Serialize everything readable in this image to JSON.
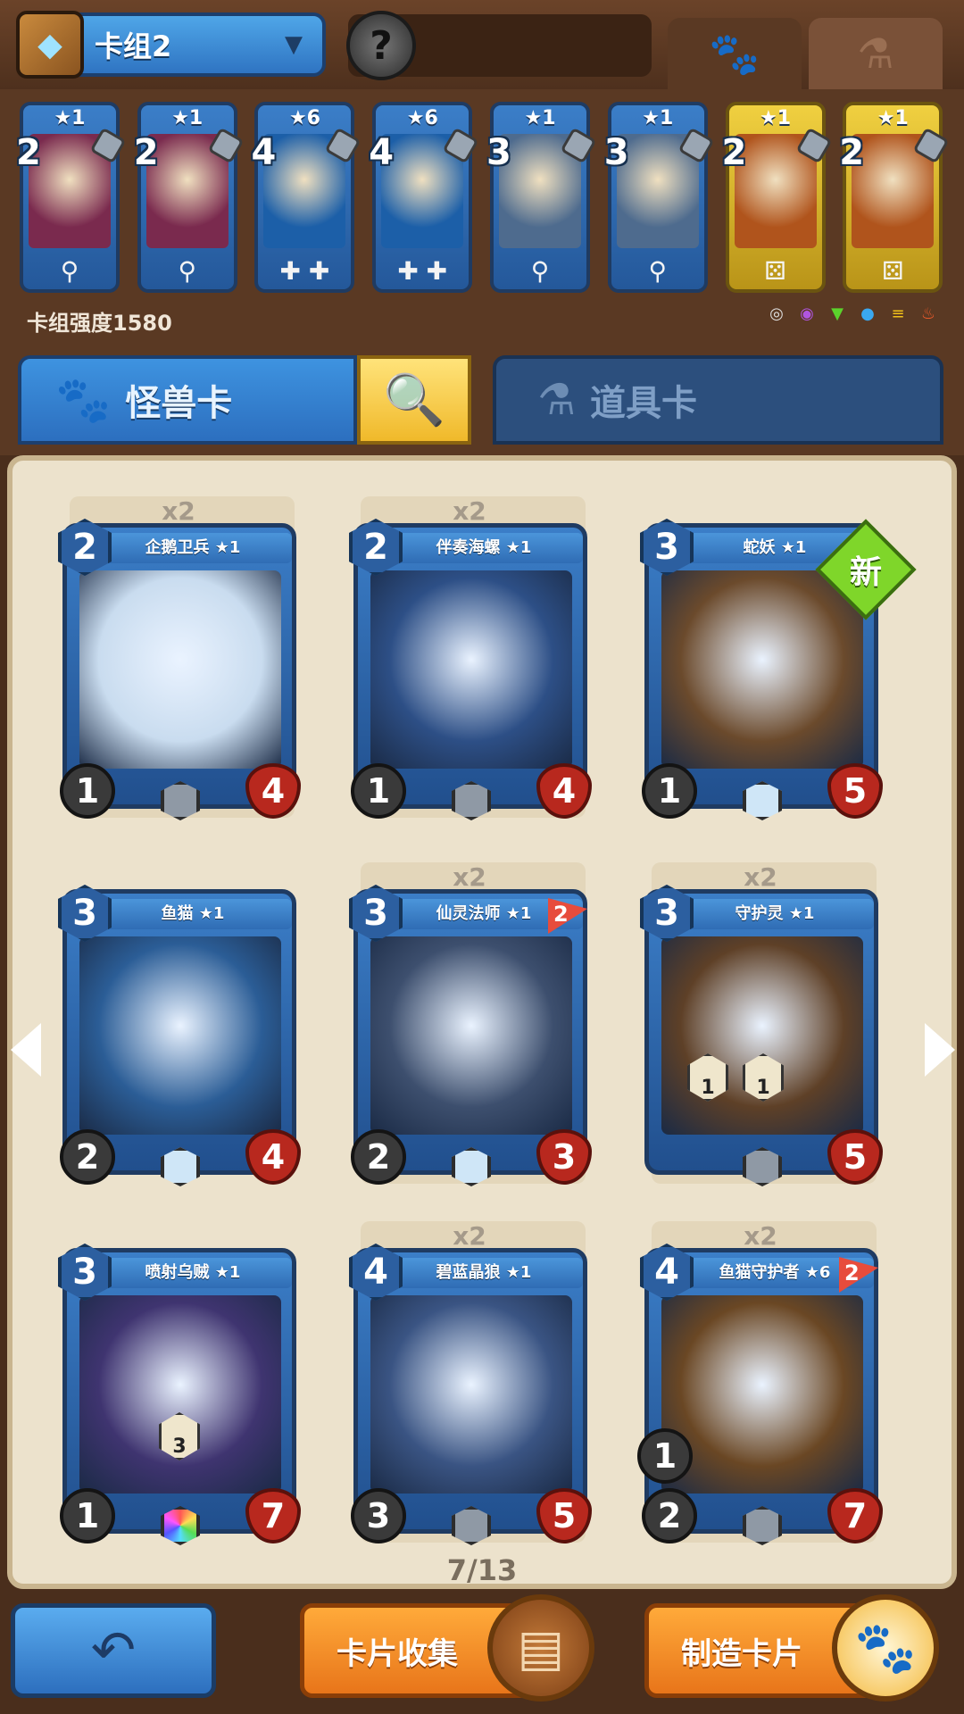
{
  "top": {
    "deck_name": "卡组2",
    "profile_icon": "?"
  },
  "deck": {
    "power_label": "卡组强度1580",
    "cards": [
      {
        "stars": "★1",
        "cost": "2",
        "foot": "⚲",
        "theme": "blue",
        "art": "#7a2a4e"
      },
      {
        "stars": "★1",
        "cost": "2",
        "foot": "⚲",
        "theme": "blue",
        "art": "#7a2a4e"
      },
      {
        "stars": "★6",
        "cost": "4",
        "foot": "✚ ✚",
        "theme": "blue",
        "art": "#1c5fa8"
      },
      {
        "stars": "★6",
        "cost": "4",
        "foot": "✚ ✚",
        "theme": "blue",
        "art": "#1c5fa8"
      },
      {
        "stars": "★1",
        "cost": "3",
        "foot": "⚲",
        "theme": "blue",
        "art": "#4e6b8e"
      },
      {
        "stars": "★1",
        "cost": "3",
        "foot": "⚲",
        "theme": "blue",
        "art": "#4e6b8e"
      },
      {
        "stars": "★1",
        "cost": "2",
        "foot": "⚄",
        "theme": "gold",
        "art": "#b0541c"
      },
      {
        "stars": "★1",
        "cost": "2",
        "foot": "⚄",
        "theme": "gold",
        "art": "#b0541c"
      }
    ],
    "elements": [
      {
        "icon": "◎",
        "color": "#e0e0e0"
      },
      {
        "icon": "◉",
        "color": "#b055e0"
      },
      {
        "icon": "▼",
        "color": "#5bd22c"
      },
      {
        "icon": "●",
        "color": "#3aa8f0"
      },
      {
        "icon": "≡",
        "color": "#f2c21a"
      },
      {
        "icon": "♨",
        "color": "#f05a2a"
      }
    ]
  },
  "tabs": {
    "monster_label": "怪兽卡",
    "item_label": "道具卡"
  },
  "collection": {
    "page": "7/13",
    "new_badge": "新",
    "cards": [
      {
        "copies": "x2",
        "name": "企鹅卫兵 ★1",
        "cost": "2",
        "atk": "1",
        "hp": "4",
        "gem": "grey",
        "art": "#c9dcef"
      },
      {
        "copies": "x2",
        "name": "伴奏海螺 ★1",
        "cost": "2",
        "atk": "1",
        "hp": "4",
        "gem": "grey",
        "art": "#2d4f86"
      },
      {
        "copies": "",
        "name": "蛇妖 ★1",
        "cost": "3",
        "atk": "1",
        "hp": "5",
        "gem": "crystal",
        "art": "#6b4a2c"
      },
      {
        "copies": "",
        "name": "鱼猫 ★1",
        "cost": "3",
        "atk": "2",
        "hp": "4",
        "gem": "crystal",
        "art": "#2b5d96"
      },
      {
        "copies": "x2",
        "name": "仙灵法师 ★1",
        "cost": "3",
        "atk": "2",
        "hp": "3",
        "gem": "crystal",
        "art": "#3d4f6e",
        "flag": "2"
      },
      {
        "copies": "x2",
        "name": "守护灵 ★1",
        "cost": "3",
        "atk": "",
        "hp": "5",
        "gem": "grey",
        "art": "#5e4027",
        "abilities": [
          "1",
          "1"
        ]
      },
      {
        "copies": "",
        "name": "喷射乌贼 ★1",
        "cost": "3",
        "atk": "1",
        "hp": "7",
        "gem": "rainbow",
        "art": "#3f3470",
        "abilities": [
          "3"
        ]
      },
      {
        "copies": "x2",
        "name": "碧蓝晶狼 ★1",
        "cost": "4",
        "atk": "3",
        "hp": "5",
        "gem": "grey",
        "art": "#3a5483"
      },
      {
        "copies": "x2",
        "name": "鱼猫守护者 ★6",
        "cost": "4",
        "atk": "2",
        "hp": "7",
        "gem": "grey",
        "art": "#6a4724",
        "flag": "2",
        "extra_atk": "1"
      }
    ]
  },
  "bottom": {
    "collect_label": "卡片收集",
    "craft_label": "制造卡片"
  }
}
